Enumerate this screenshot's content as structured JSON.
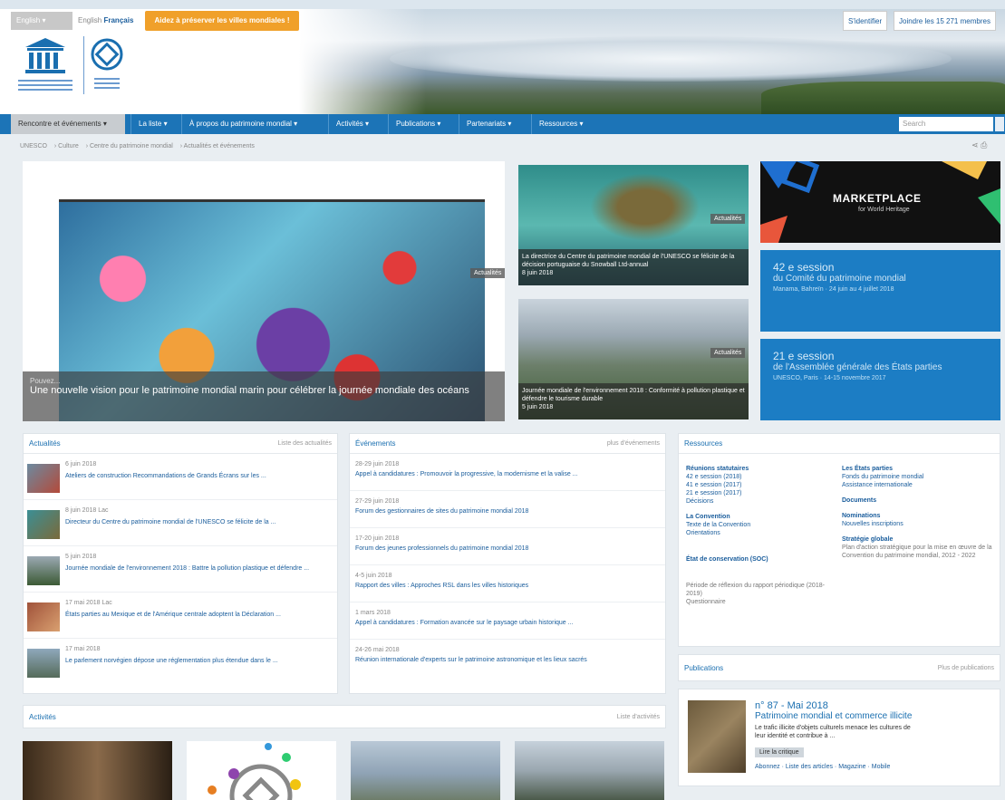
{
  "header": {
    "lang_select": "English ▾",
    "lang_links_prefix": "English",
    "lang_active": "Français",
    "promo_button": "Aidez à préserver les villes mondiales !",
    "identify_button": "S'identifier",
    "join_button": "Joindre les 15 271 membres",
    "logo1_caption": "Nations Unies pour l'éducation, la science et la culture",
    "logo2_caption": "Patrimoine Mondial"
  },
  "nav": {
    "first": "Rencontre et événements ▾",
    "items": [
      "La liste ▾",
      "À propos du patrimoine mondial ▾",
      "Activités ▾",
      "Publications ▾",
      "Partenariats ▾",
      "Ressources ▾"
    ],
    "search_placeholder": "Search"
  },
  "breadcrumb": [
    "UNESCO",
    "› Culture",
    "› Centre du patrimoine mondial",
    "› Actualités et événements"
  ],
  "feature_main": {
    "tag": "Actualités",
    "small": "Pouvez...",
    "title": "Une nouvelle vision pour le patrimoine mondial marin pour célébrer la journée mondiale des océans"
  },
  "feature_turtle": {
    "tag": "Actualités",
    "caption": "La directrice du Centre du patrimoine mondial de l'UNESCO se félicite de la décision portuguaise du Snowball Ltd-annual",
    "date": "8 juin 2018"
  },
  "feature_mountain": {
    "tag": "Actualités",
    "caption": "Journée mondiale de l'environnement 2018 : Conformité à pollution plastique et défendre le tourisme durable",
    "date": "5 juin 2018"
  },
  "marketplace": {
    "title": "MARKETPLACE",
    "subtitle": "for World Heritage"
  },
  "sessions": [
    {
      "num": "42 e session",
      "sub": "du Comité du patrimoine mondial",
      "small": "Manama, Bahreïn · 24 juin au 4 juillet 2018"
    },
    {
      "num": "21 e session",
      "sub": "de l'Assemblée générale des États parties",
      "small": "UNESCO, Paris · 14-15 novembre 2017"
    }
  ],
  "news_panel": {
    "title": "Actualités",
    "more": "Liste des actualités",
    "items": [
      {
        "date": "6 juin 2018",
        "text": "Ateliers de construction Recommandations de Grands Écrans sur les ..."
      },
      {
        "date": "8 juin 2018 Lac",
        "text": "Directeur du Centre du patrimoine mondial de l'UNESCO se félicite de la ..."
      },
      {
        "date": "5 juin 2018",
        "text": "Journée mondiale de l'environnement 2018 : Battre la pollution plastique et défendre ..."
      },
      {
        "date": "17 mai 2018 Lac",
        "text": "États parties au Mexique et de l'Amérique centrale adoptent la Déclaration ..."
      },
      {
        "date": "17 mai 2018",
        "text": "Le parlement norvégien dépose une réglementation plus étendue dans le ..."
      }
    ]
  },
  "events_panel": {
    "title": "Événements",
    "more": "plus d'événements",
    "items": [
      {
        "date": "28-29 juin 2018",
        "text": "Appel à candidatures : Promouvoir la progressive, la modernisme et la valise ..."
      },
      {
        "date": "27-29 juin 2018",
        "text": "Forum des gestionnaires de sites du patrimoine mondial 2018"
      },
      {
        "date": "17-20 juin 2018",
        "text": "Forum des jeunes professionnels du patrimoine mondial 2018"
      },
      {
        "date": "4-5 juin 2018",
        "text": "Rapport des villes : Approches RSL dans les villes historiques"
      },
      {
        "date": "1 mars 2018",
        "text": "Appel à candidatures : Formation avancée sur le paysage urbain historique ..."
      },
      {
        "date": "24-26 mai 2018",
        "text": "Réunion internationale d'experts sur le patrimoine astronomique et les lieux sacrés"
      }
    ]
  },
  "resources_panel": {
    "title": "Ressources",
    "left": [
      {
        "head": "Réunions statutaires",
        "items": [
          "42 e session (2018)",
          "41 e session (2017)",
          "21 e session (2017)",
          "Décisions"
        ]
      },
      {
        "head": "La Convention",
        "items": [
          "Texte de la Convention",
          "Orientations"
        ]
      },
      {
        "head": "État de conservation (SOC)",
        "items": []
      },
      {
        "head": "",
        "items": [
          "Période de réflexion du rapport périodique (2018-2019)",
          "Questionnaire"
        ]
      }
    ],
    "right": [
      {
        "head": "Les États parties",
        "items": [
          "Fonds du patrimoine mondial",
          "Assistance internationale"
        ]
      },
      {
        "head": "Documents",
        "items": []
      },
      {
        "head": "Nominations",
        "items": [
          "Nouvelles inscriptions"
        ]
      },
      {
        "head": "Stratégie globale",
        "items": [
          "Plan d'action stratégique pour la mise en œuvre de la Convention du patrimoine mondial, 2012 - 2022"
        ]
      }
    ]
  },
  "publications_panel": {
    "title": "Publications",
    "more": "Plus de publications",
    "number": "n° 87 - Mai 2018",
    "pub_title": "Patrimoine mondial et commerce illicite",
    "desc": "Le trafic illicite d'objets culturels menace les cultures de leur identité et contribue à ...",
    "button": "Lire la critique",
    "links": "Abonnez · Liste des articles · Magazine · Mobile"
  },
  "activities_panel": {
    "title": "Activités",
    "more": "Liste d'activités"
  }
}
